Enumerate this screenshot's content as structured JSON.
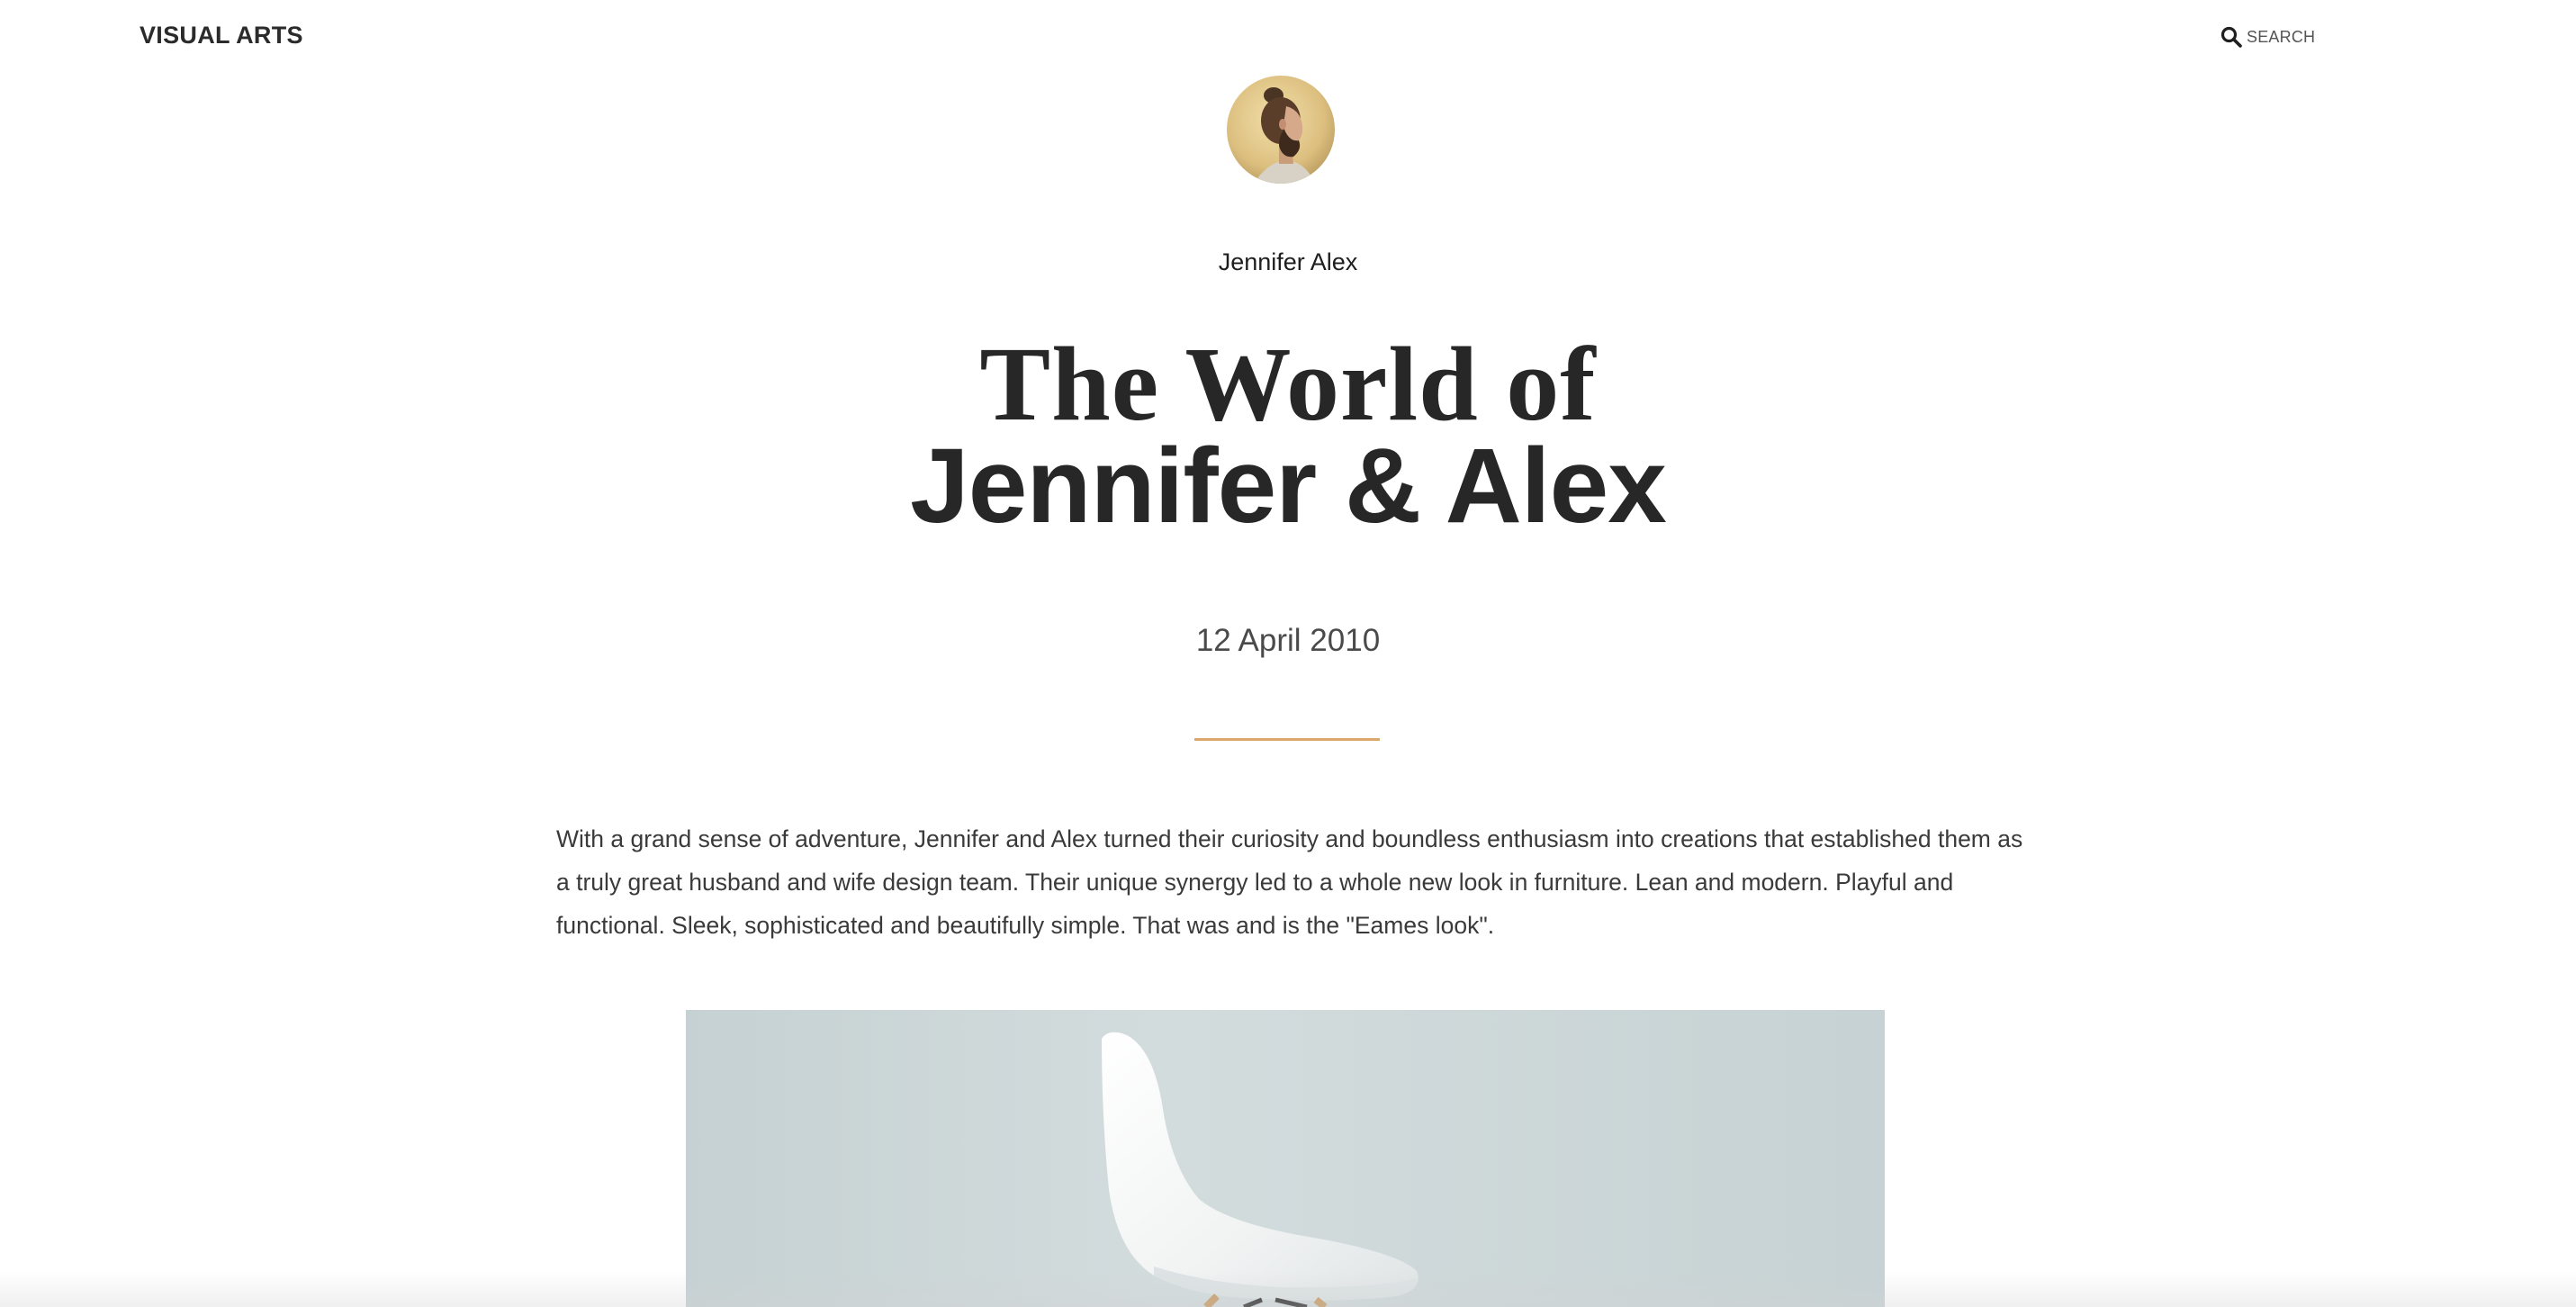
{
  "header": {
    "brand": "VISUAL ARTS",
    "search_label": "SEARCH",
    "search_icon": "search-icon"
  },
  "article": {
    "avatar_icon": "author-avatar",
    "author": "Jennifer Alex",
    "title_line1": "The World of",
    "title_line2": "Jennifer & Alex",
    "date": "12 April 2010",
    "divider_color": "#d9a86a",
    "intro": "With a grand sense of adventure, Jennifer and Alex turned their curiosity and boundless enthusiasm into creations that established them as a truly great husband and wife design team. Their unique synergy led to a whole new look in furniture. Lean and modern. Playful and functional. Sleek, sophisticated and beautifully simple. That was and is the \"Eames look\".",
    "hero_image": "white-chair-photo"
  },
  "colors": {
    "accent": "#d9a86a",
    "text": "#2d2d2d",
    "hero_bg": "#c9d5d7"
  }
}
